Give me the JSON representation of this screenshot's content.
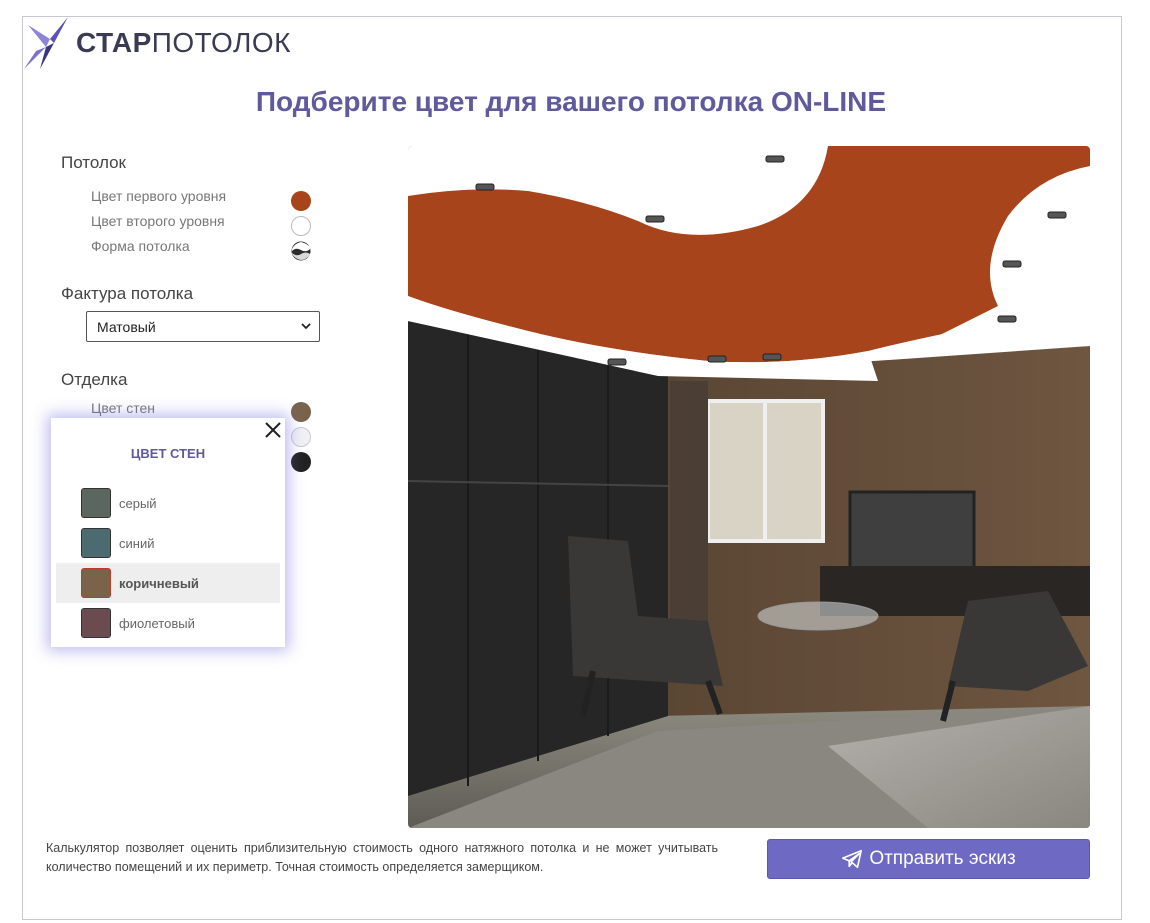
{
  "brand": {
    "name_bold": "СТАР",
    "name_light": "ПОТОЛОК"
  },
  "page_title": "Подберите цвет для вашего потолка ON-LINE",
  "ceiling": {
    "title": "Потолок",
    "options": [
      {
        "label": "Цвет первого уровня",
        "color": "#a8441b"
      },
      {
        "label": "Цвет второго уровня",
        "color": "#ffffff"
      },
      {
        "label": "Форма потолка",
        "icon": "ceiling-shape-icon"
      }
    ]
  },
  "texture": {
    "title": "Фактура потолка",
    "selected": "Матовый"
  },
  "finish": {
    "title": "Отделка",
    "options": [
      {
        "label": "Цвет стен",
        "color": "#7a634b"
      }
    ],
    "hidden_swatches": [
      "#f1f1f4",
      "#222222"
    ]
  },
  "wall_color_popup": {
    "title": "ЦВЕТ СТЕН",
    "items": [
      {
        "label": "серый",
        "color": "#5c6660",
        "selected": false
      },
      {
        "label": "синий",
        "color": "#4a6b70",
        "selected": false
      },
      {
        "label": "коричневый",
        "color": "#7a634b",
        "selected": true
      },
      {
        "label": "фиолетовый",
        "color": "#6a4c50",
        "selected": false
      }
    ]
  },
  "footnote": "Калькулятор позволяет оценить приблизительную стоимость одного натяжного потолка и не может учитывать количество помещений и их периметр. Точная стоимость определяется замерщиком.",
  "send_button": {
    "label": "Отправить эскиз",
    "icon": "paper-plane-icon",
    "color": "#6e6ac4"
  }
}
